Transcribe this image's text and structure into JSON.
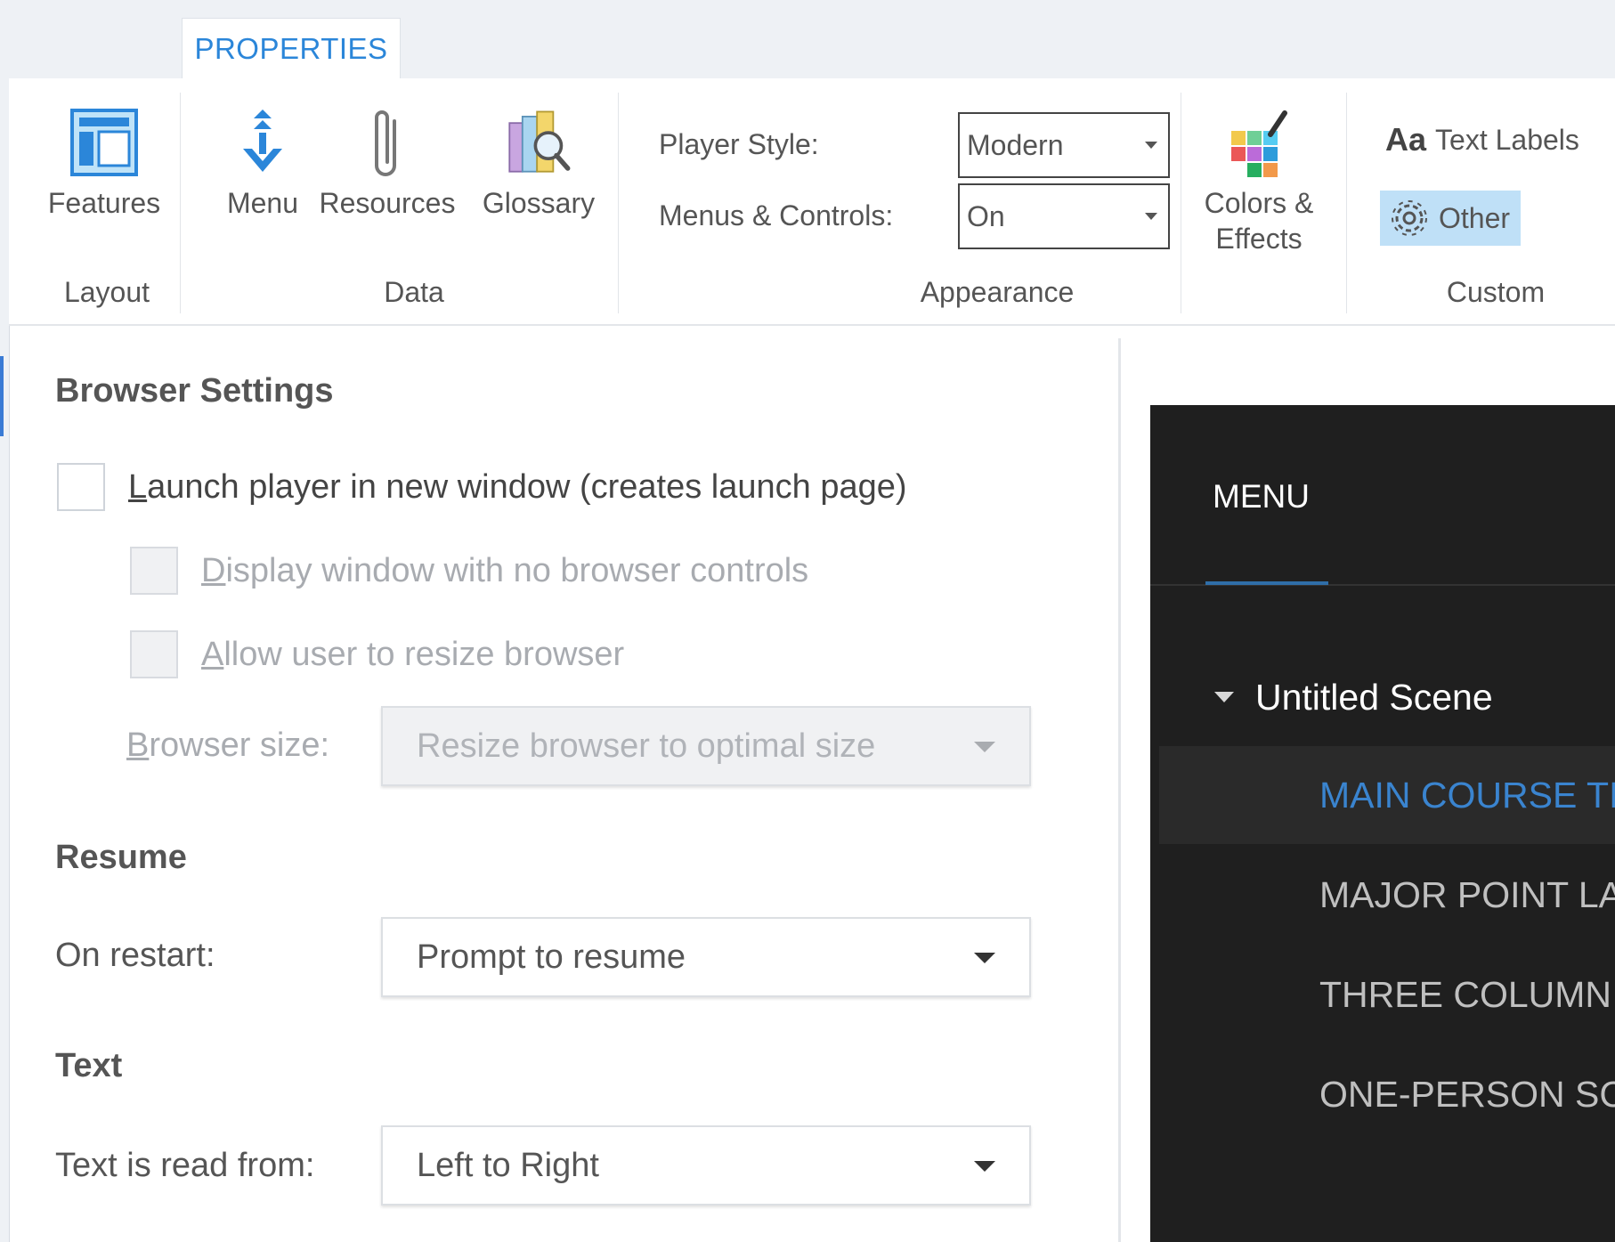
{
  "tabs": {
    "active": "PROPERTIES"
  },
  "ribbon": {
    "layout": {
      "label": "Layout",
      "features": "Features"
    },
    "data": {
      "label": "Data",
      "menu": "Menu",
      "resources": "Resources",
      "glossary": "Glossary"
    },
    "appearance": {
      "label": "Appearance",
      "player_style_label": "Player Style:",
      "player_style_value": "Modern",
      "menus_controls_label": "Menus & Controls:",
      "menus_controls_value": "On",
      "colors_effects_line1": "Colors &",
      "colors_effects_line2": "Effects"
    },
    "custom": {
      "label": "Custom",
      "text_labels_prefix": "Aa",
      "text_labels": "Text Labels",
      "other": "Other"
    }
  },
  "browser_settings": {
    "heading": "Browser Settings",
    "launch_new_window": {
      "u": "L",
      "rest": "aunch player in new window (creates launch page)",
      "checked": false
    },
    "no_browser_controls": {
      "u": "D",
      "rest": "isplay window with no browser controls",
      "checked": false
    },
    "allow_resize": {
      "u": "A",
      "rest": "llow user to resize browser",
      "checked": false
    },
    "browser_size": {
      "u": "B",
      "rest": "rowser size:",
      "value": "Resize browser to optimal size"
    }
  },
  "resume": {
    "heading": "Resume",
    "label": "On restart:",
    "value": "Prompt to resume"
  },
  "text": {
    "heading": "Text",
    "label": "Text is read from:",
    "value": "Left to Right"
  },
  "preview": {
    "menu_tab": "MENU",
    "scene_title": "Untitled Scene",
    "slides": [
      "MAIN COURSE TI",
      "MAJOR POINT LA",
      "THREE COLUMN",
      "ONE-PERSON SC"
    ],
    "selected_index": 0
  },
  "colors": {
    "accent": "#2b86d9",
    "preview_bg": "#1f1f1f",
    "selected_slide": "#3a84cf",
    "other_highlight": "#bfe0f7"
  }
}
